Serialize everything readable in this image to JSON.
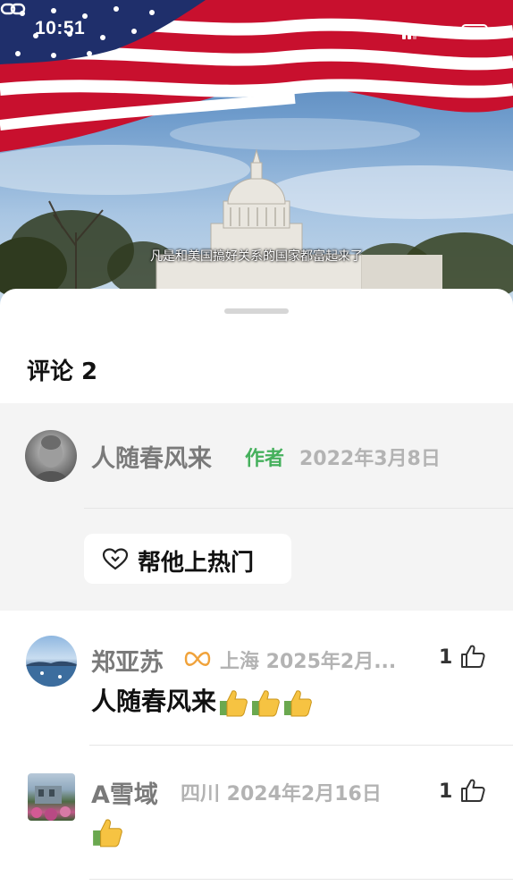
{
  "status_bar": {
    "time": "10:51"
  },
  "video": {
    "subtitle": "凡是和美国搞好关系的国家都富起来了"
  },
  "comments_panel": {
    "title": "评论 2",
    "pinned": {
      "author": "人随春风来",
      "author_tag": "作者",
      "date": "2022年3月8日",
      "boost_label": "帮他上热门"
    },
    "comments": [
      {
        "author": "郑亚苏",
        "location_date": "上海 2025年2月...",
        "likes": "1",
        "text": "人随春风来",
        "emoji_count": 3,
        "has_badge": true
      },
      {
        "author": "A雪域",
        "location_date": "四川 2024年2月16日",
        "likes": "1",
        "text": "",
        "emoji_count": 1,
        "has_badge": false
      }
    ]
  },
  "colors": {
    "author_tag": "#45b05c",
    "name_gray": "#7a7a7a",
    "meta_gray": "#b3b3b3",
    "badge_orange": "#f0a23a"
  },
  "icons": [
    "signal-icon",
    "link-icon",
    "battery-icon",
    "heart-boost-icon",
    "thumbs-up-icon",
    "thumbs-up-emoji",
    "infinity-badge-icon"
  ]
}
